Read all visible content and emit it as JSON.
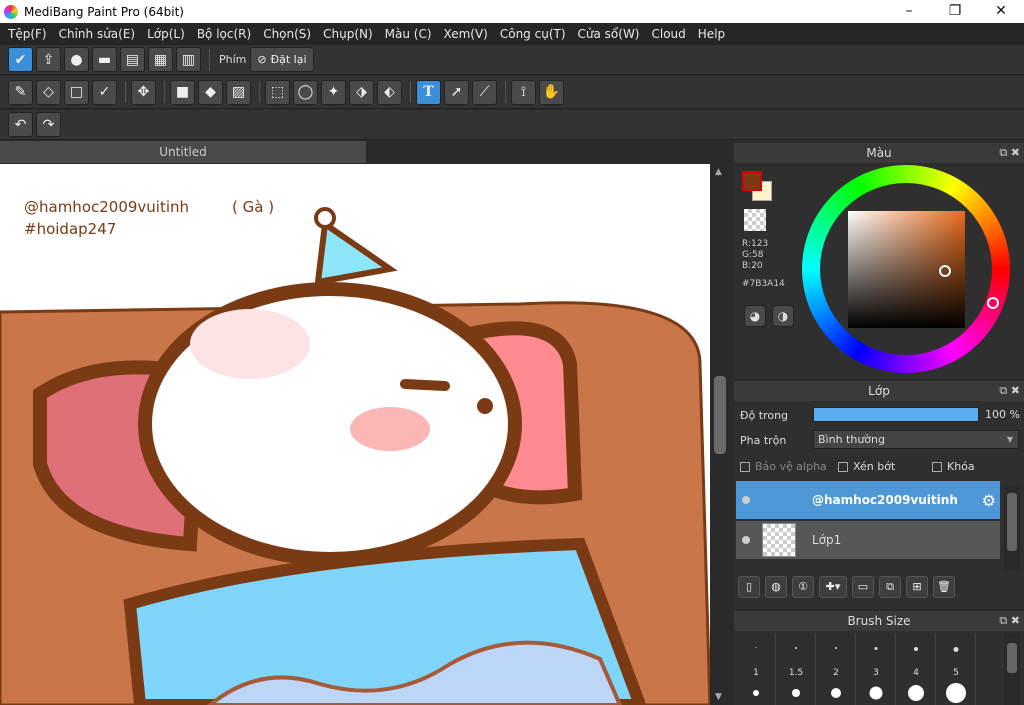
{
  "window": {
    "title": "MediBang Paint Pro (64bit)",
    "minimize": "–",
    "maximize": "❐",
    "close": "✕"
  },
  "menu": [
    "Tệp(F)",
    "Chỉnh sửa(E)",
    "Lớp(L)",
    "Bộ lọc(R)",
    "Chọn(S)",
    "Chụp(N)",
    "Màu (C)",
    "Xem(V)",
    "Công cụ(T)",
    "Cửa sổ(W)",
    "Cloud",
    "Help"
  ],
  "toolbar1": {
    "phim_label": "Phím",
    "reset_label": "Đặt lại"
  },
  "doc": {
    "tab_title": "Untitled"
  },
  "canvas": {
    "text_line1": "@hamhoc2009vuitinh",
    "text_ga": "( Gà )",
    "text_line2": "#hoidap247"
  },
  "color_panel": {
    "title": "Màu",
    "r": "R:123",
    "g": "G:58",
    "b": "B:20",
    "hex": "#7B3A14",
    "fg_color": "#7B3A14"
  },
  "layer_panel": {
    "title": "Lớp",
    "opacity_label": "Độ trong",
    "opacity_value": "100 %",
    "opacity": 1.0,
    "blend_label": "Pha trộn",
    "blend_value": "Bình thường",
    "protect_alpha": "Bảo vệ alpha",
    "clipping": "Xén bớt",
    "lock": "Khóa",
    "layers": [
      {
        "name": "@hamhoc2009vuitinh",
        "selected": true
      },
      {
        "name": "Lớp1",
        "selected": false
      }
    ]
  },
  "brush_panel": {
    "title": "Brush Size",
    "sizes": [
      "1",
      "1.5",
      "2",
      "3",
      "4",
      "5"
    ]
  }
}
